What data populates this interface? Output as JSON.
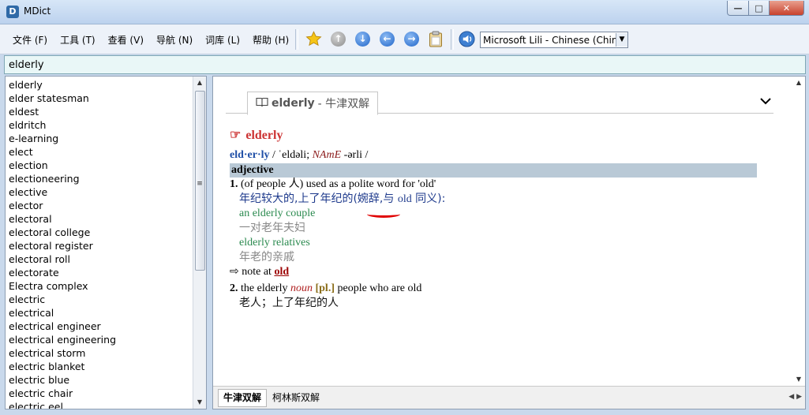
{
  "window": {
    "title": "MDict",
    "app_icon": "mdict-logo",
    "min_label": "—",
    "max_label": "□",
    "close_label": "✕"
  },
  "menu": [
    {
      "label": "文件 (F)"
    },
    {
      "label": "工具 (T)"
    },
    {
      "label": "查看 (V)"
    },
    {
      "label": "导航 (N)"
    },
    {
      "label": "词库 (L)"
    },
    {
      "label": "帮助 (H)"
    }
  ],
  "toolbar": {
    "icons": [
      "star-icon",
      "up-icon",
      "down-icon",
      "back-icon",
      "forward-icon",
      "clipboard-icon",
      "speaker-icon"
    ],
    "voice_selected": "Microsoft Lili - Chinese (China)"
  },
  "search": {
    "value": "elderly"
  },
  "wordlist": [
    "elderly",
    "elder statesman",
    "eldest",
    "eldritch",
    "e-learning",
    "elect",
    "election",
    "electioneering",
    "elective",
    "elector",
    "electoral",
    "electoral college",
    "electoral register",
    "electoral roll",
    "electorate",
    "Electra complex",
    "electric",
    "electrical",
    "electrical engineer",
    "electrical engineering",
    "electrical storm",
    "electric blanket",
    "electric blue",
    "electric chair",
    "electric eel"
  ],
  "entry_tab": {
    "word": "elderly",
    "dict": "- 牛津双解"
  },
  "entry": {
    "headword": "elderly",
    "syllables": "eld·er·ly",
    "pron_sep1": "/",
    "br": "ˈeldəli;",
    "ame_label": "NAmE",
    "ame": "-ərli /",
    "pos": "adjective",
    "s1_num": "1.",
    "s1_def": "(of people 人) used as a polite word for 'old'",
    "s1_cn_a": "年纪较大的,上了年纪的(婉辞,与",
    "s1_cn_ref": "old",
    "s1_cn_b": "同义):",
    "ex1": "an elderly couple",
    "ex1_cn": "一对老年夫妇",
    "ex2": "elderly relatives",
    "ex2_cn": "年老的亲戚",
    "note_prefix": "⇨ note at",
    "note_ref": "old",
    "s2_num": "2.",
    "s2_a": "the elderly",
    "s2_noun": "noun",
    "s2_gram": "[pl.]",
    "s2_def": "people who are old",
    "s2_cn": "老人；上了年纪的人"
  },
  "bottom_tabs": [
    {
      "label": "牛津双解",
      "active": true
    },
    {
      "label": "柯林斯双解",
      "active": false
    }
  ]
}
